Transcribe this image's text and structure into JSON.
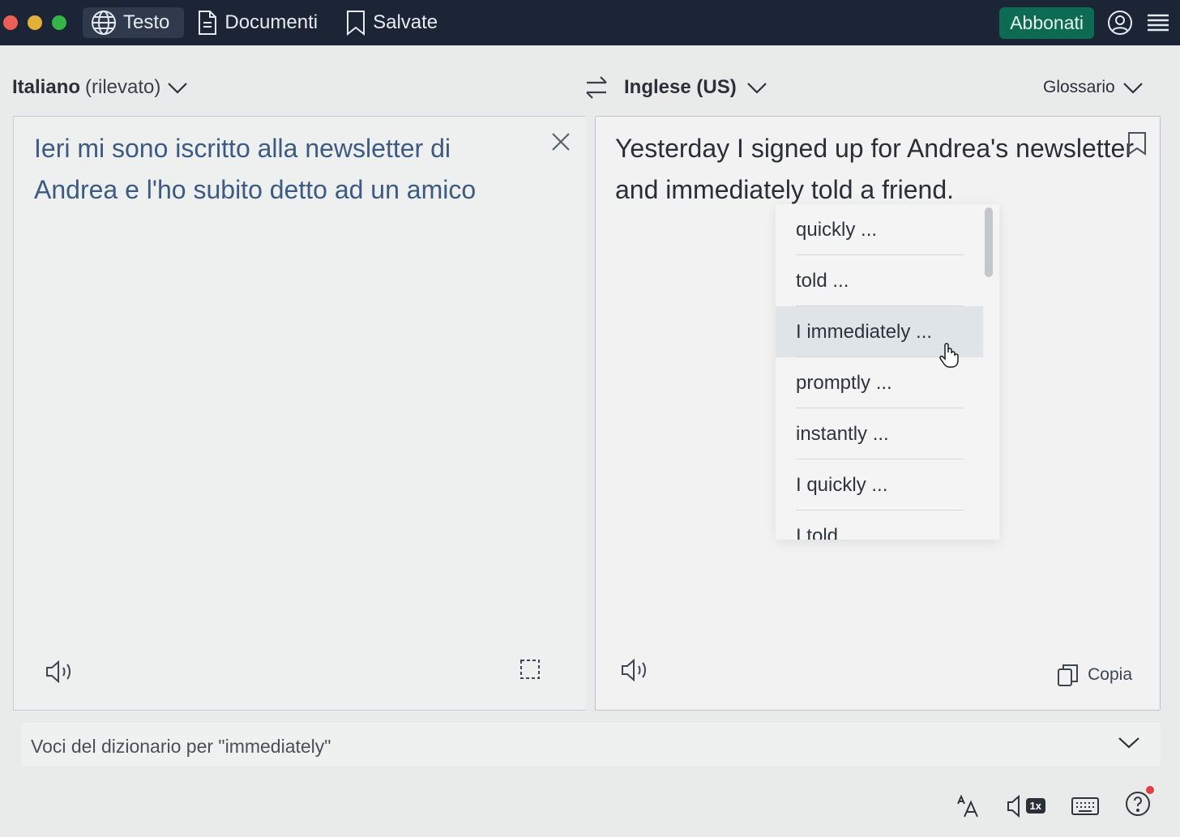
{
  "topbar": {
    "tabs": [
      {
        "label": "Testo",
        "icon": "globe-icon",
        "active": true
      },
      {
        "label": "Documenti",
        "icon": "document-icon",
        "active": false
      },
      {
        "label": "Salvate",
        "icon": "bookmark-icon",
        "active": false
      }
    ],
    "subscribe_label": "Abbonati",
    "colors": {
      "bar": "#1b2536",
      "subscribe": "#0c6b52"
    }
  },
  "languages": {
    "source_name": "Italiano",
    "source_detected": "(rilevato)",
    "target_name": "Inglese (US)",
    "glossary_label": "Glossario"
  },
  "source": {
    "text": "Ieri mi sono iscritto alla newsletter di Andrea e l'ho subito detto ad un amico"
  },
  "target": {
    "text": "Yesterday I signed up for Andrea's newsletter and immediately told a friend.",
    "copy_label": "Copia"
  },
  "alternatives": [
    "quickly ...",
    "told ...",
    "I immediately ...",
    "promptly ...",
    "instantly ...",
    "I quickly ...",
    "I told"
  ],
  "dictionary": {
    "label": "Voci del dizionario per \"immediately\""
  },
  "bottom_tools": {
    "speed_label": "1x"
  }
}
